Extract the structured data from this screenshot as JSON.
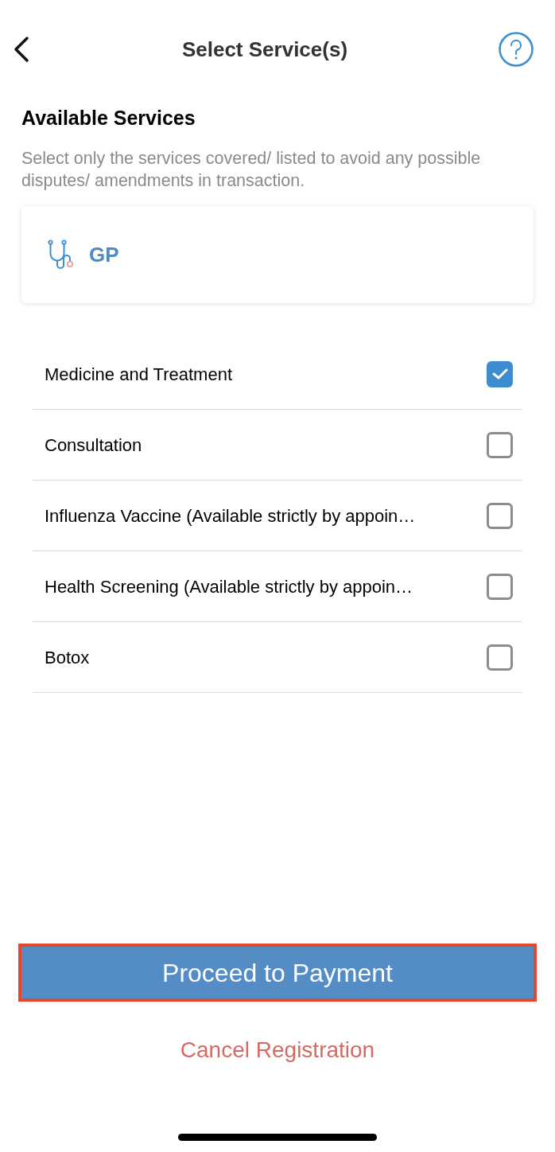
{
  "header": {
    "title": "Select Service(s)"
  },
  "section": {
    "heading": "Available Services",
    "description": "Select only the services covered/ listed to avoid any possible disputes/ amendments in transaction."
  },
  "category": {
    "label": "GP"
  },
  "services": [
    {
      "label": "Medicine and Treatment",
      "checked": true
    },
    {
      "label": "Consultation",
      "checked": false
    },
    {
      "label": "Influenza Vaccine (Available strictly by appoin…",
      "checked": false
    },
    {
      "label": "Health Screening (Available strictly by appoin…",
      "checked": false
    },
    {
      "label": "Botox",
      "checked": false
    }
  ],
  "primary_button": {
    "label": "Proceed to Payment",
    "highlighted": true
  },
  "secondary_link": {
    "label": "Cancel Registration"
  }
}
